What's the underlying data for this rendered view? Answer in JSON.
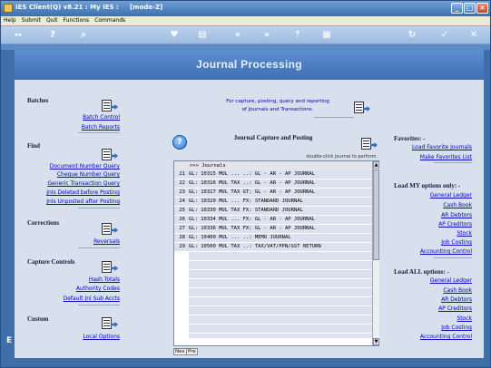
{
  "window": {
    "title": "IES Client(Q) v8.21 : My IES :     [mode-Z]"
  },
  "menu": [
    "Help",
    "Submit",
    "Quit",
    "Functions",
    "Commands"
  ],
  "page_title": "Journal Processing",
  "batches": {
    "heading": "Batches",
    "links": [
      "Batch Control",
      "Batch Reports"
    ]
  },
  "find": {
    "heading": "Find",
    "links": [
      "Document Number Query",
      "Cheque Number Query",
      "Generic Transaction Query",
      "Jnls Deleted before Posting",
      "Jnls Unposted after Posting"
    ]
  },
  "corrections": {
    "heading": "Corrections",
    "links": [
      "Reversals"
    ]
  },
  "capture_controls": {
    "heading": "Capture Controls",
    "links": [
      "Hash Totals",
      "Authority Codes",
      "Default Jnl Sub Accts"
    ]
  },
  "custom": {
    "heading": "Custom",
    "links": [
      "Local Options"
    ]
  },
  "intro": {
    "line1": "For capture, posting, query and reporting",
    "line2": "of Journals and Transactions."
  },
  "capture": {
    "heading": "Journal Capture and Posting",
    "hint": "double-click journal to perform.",
    "list_header": ">>> Journals",
    "rows": [
      {
        "n": "21",
        "text": "GL: 10315 MUL ... ..: GL - AR - AP JOURNAL"
      },
      {
        "n": "22",
        "text": "GL: 10316 MUL TAX ..: GL - AR - AP JOURNAL"
      },
      {
        "n": "23",
        "text": "GL: 10317 MUL TAX GT: GL - AR - AP JOURNAL"
      },
      {
        "n": "24",
        "text": "GL: 10320 MUL ... FX: STANDARD JOURNAL"
      },
      {
        "n": "25",
        "text": "GL: 10330 MUL TAX FX: STANDARD JOURNAL"
      },
      {
        "n": "26",
        "text": "GL: 10334 MUL ... FX: GL - AR - AP JOURNAL"
      },
      {
        "n": "27",
        "text": "GL: 10336 MUL TAX FX: GL - AR - AP JOURNAL"
      },
      {
        "n": "28",
        "text": "GL: 10400 MUL ... ..: MEMO JOURNAL"
      },
      {
        "n": "29",
        "text": "GL: 10500 MUL TAX ..: TAX/VAT/PPN/GST RETURN"
      }
    ],
    "nav": [
      "Nex",
      "Pre"
    ]
  },
  "favorites": {
    "heading": "Favorites: -",
    "links": [
      "Load Favorite Journals",
      "Make Favorites List"
    ]
  },
  "my_options": {
    "heading": "Load MY options only: -",
    "links": [
      "General Ledger",
      "Cash Book",
      "AR Debtors",
      "AP Creditors",
      "Stock",
      "Job Costing",
      "Accounting Control"
    ]
  },
  "all_options": {
    "heading": "Load ALL options: -",
    "links": [
      "General Ledger",
      "Cash Book",
      "AR Debtors",
      "AP Creditors",
      "Stock",
      "Job Costing",
      "Accounting Control"
    ]
  }
}
